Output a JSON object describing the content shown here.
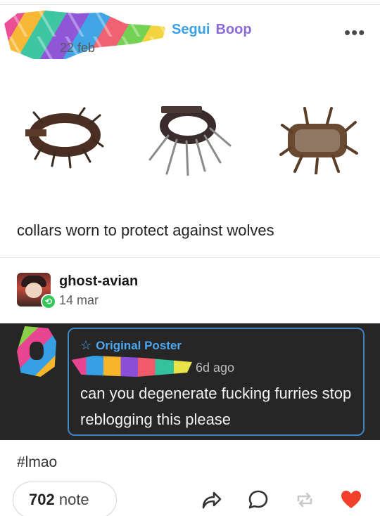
{
  "post": {
    "date": "22 feb",
    "author_primary": "Segui",
    "author_secondary": "Boop",
    "more_icon": "more-dots-icon",
    "caption": "collars worn to protect against wolves"
  },
  "reblog": {
    "user": "ghost-avian",
    "date": "14 mar"
  },
  "reply": {
    "badge": "Original Poster",
    "ago": "6d ago",
    "text": "can you degenerate fucking furries stop reblogging this please"
  },
  "footer": {
    "tag": "#lmao",
    "notes_count": "702",
    "notes_word": "note",
    "actions": [
      "share-icon",
      "comment-icon",
      "reblog-icon",
      "like-heart-icon"
    ]
  },
  "colors": {
    "name_primary": "#3aa0e8",
    "name_secondary": "#8a6bd8",
    "op_accent": "#4da6f0",
    "dark_bg": "#262626",
    "heart": "#f2412a"
  }
}
